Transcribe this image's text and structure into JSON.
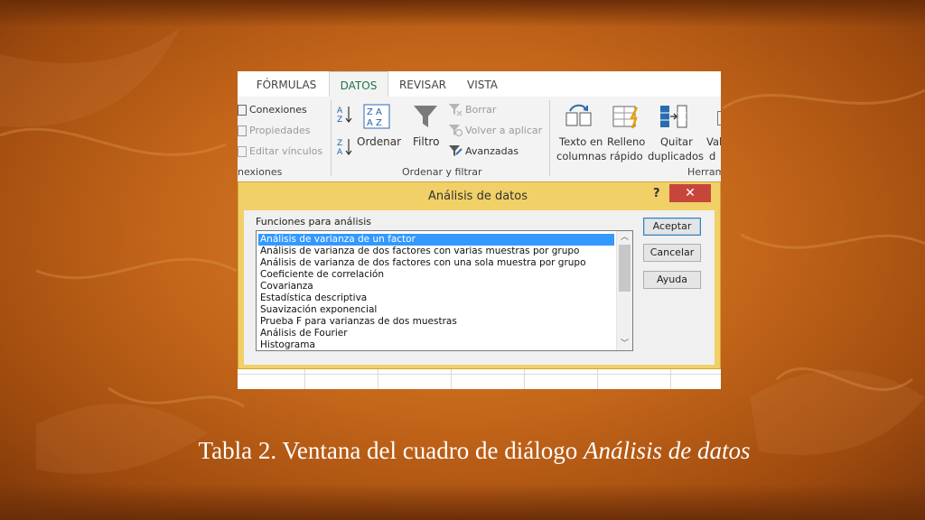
{
  "ribbon": {
    "tabs": [
      "FÓRMULAS",
      "DATOS",
      "REVISAR",
      "VISTA"
    ],
    "active_tab": "DATOS",
    "connections": {
      "items": [
        "Conexiones",
        "Propiedades",
        "Editar vínculos"
      ],
      "group_label": "nexiones"
    },
    "sort_filter": {
      "sort_label": "Ordenar",
      "filter_label": "Filtro",
      "clear_label": "Borrar",
      "reapply_label": "Volver a aplicar",
      "advanced_label": "Avanzadas",
      "group_label": "Ordenar y filtrar"
    },
    "tools": {
      "text_to_columns": [
        "Texto en",
        "columnas"
      ],
      "flash_fill": [
        "Relleno",
        "rápido"
      ],
      "remove_duplicates": [
        "Quitar",
        "duplicados"
      ],
      "cut_label": "Val",
      "cut_label2": "d",
      "group_label": "Herram"
    }
  },
  "dialog": {
    "title": "Análisis de datos",
    "help": "?",
    "close": "✕",
    "list_label": "Funciones para análisis",
    "functions": [
      "Análisis de varianza de un factor",
      "Análisis de varianza de dos factores con varias muestras por grupo",
      "Análisis de varianza de dos factores con una sola muestra por grupo",
      "Coeficiente de correlación",
      "Covarianza",
      "Estadística descriptiva",
      "Suavización exponencial",
      "Prueba F para varianzas de dos muestras",
      "Análisis de Fourier",
      "Histograma"
    ],
    "selected_index": 0,
    "buttons": {
      "ok": "Aceptar",
      "cancel": "Cancelar",
      "help": "Ayuda"
    }
  },
  "caption": {
    "prefix": "Tabla 2. Ventana del cuadro de diálogo ",
    "italic": "Análisis de datos"
  },
  "colors": {
    "accent_green": "#217346",
    "selection_blue": "#3399ff",
    "close_red": "#c7463c",
    "dialog_frame": "#f0d067"
  }
}
